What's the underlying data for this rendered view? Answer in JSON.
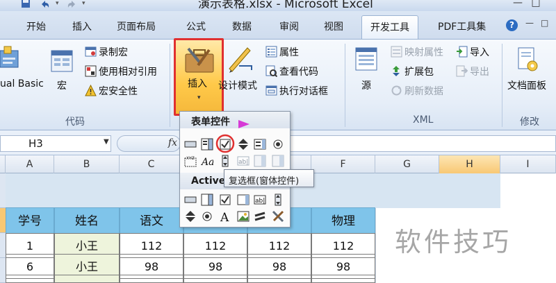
{
  "window": {
    "title": "演示表格.xlsx - Microsoft Excel"
  },
  "tabs": [
    "开始",
    "插入",
    "页面布局",
    "公式",
    "数据",
    "审阅",
    "视图",
    "开发工具",
    "PDF工具集"
  ],
  "active_tab": "开发工具",
  "ribbon": {
    "code_group": {
      "label": "代码",
      "vb_label": "ual Basic",
      "macro_label": "宏",
      "record_macro": "录制宏",
      "relative_ref": "使用相对引用",
      "macro_security": "宏安全性"
    },
    "controls_group": {
      "insert_label": "插入",
      "design_mode": "设计模式",
      "properties": "属性",
      "view_code": "查看代码",
      "run_dialog": "执行对话框"
    },
    "xml_group": {
      "label": "XML",
      "source": "源",
      "map_props": "映射属性",
      "expansion": "扩展包",
      "refresh": "刷新数据",
      "import": "导入",
      "export": "导出"
    },
    "modify_group": {
      "label": "修改",
      "doc_panel": "文档面板"
    }
  },
  "formula_bar": {
    "cell_ref": "H3",
    "fx": "fx"
  },
  "columns": [
    "A",
    "B",
    "C",
    "D",
    "E",
    "F",
    "G",
    "H",
    "I"
  ],
  "table": {
    "headers": [
      "学号",
      "姓名",
      "语文",
      "",
      "",
      "物理"
    ],
    "rows": [
      [
        "1",
        "小王",
        "112",
        "112",
        "112",
        "112"
      ],
      [
        "6",
        "小王",
        "98",
        "98",
        "98",
        "98"
      ]
    ]
  },
  "dropdown": {
    "form_controls_title": "表单控件",
    "activex_title": "Active",
    "tooltip": "复选框(窗体控件)"
  },
  "watermark": "软件技巧",
  "colors": {
    "accent_red": "#e03030",
    "header_blue": "#7fc4ea",
    "ribbon_bg": "#e6eef8"
  }
}
